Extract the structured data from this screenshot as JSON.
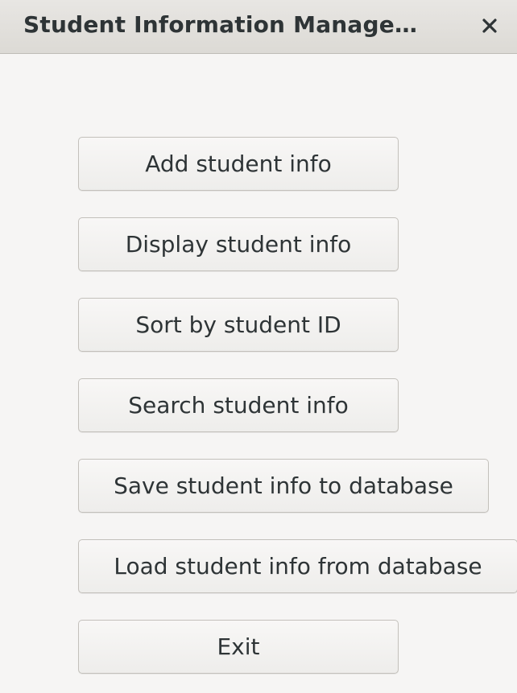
{
  "window": {
    "title": "Student Information Manage…"
  },
  "menu": {
    "add_label": "Add student info",
    "display_label": "Display student info",
    "sort_label": "Sort by student ID",
    "search_label": "Search student info",
    "save_label": "Save student info to database",
    "load_label": "Load student info from database",
    "exit_label": "Exit"
  },
  "colors": {
    "text": "#2e3436",
    "background": "#f6f5f4",
    "titlebar": "#dcdad5"
  }
}
